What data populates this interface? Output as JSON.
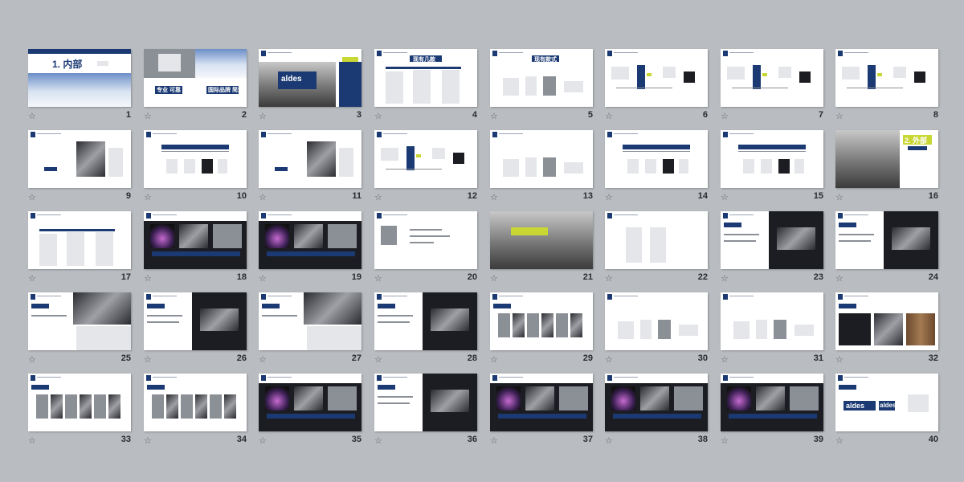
{
  "slides": [
    {
      "num": "1",
      "title": "1. 内部",
      "kind": "cover"
    },
    {
      "num": "2",
      "title": "专业  可靠",
      "title2": "国际品牌  简洁",
      "kind": "collage"
    },
    {
      "num": "3",
      "title": "aldes",
      "kind": "building"
    },
    {
      "num": "4",
      "title": "现有几款",
      "kind": "products"
    },
    {
      "num": "5",
      "title": "现有款式",
      "kind": "products2"
    },
    {
      "num": "6",
      "title": "",
      "kind": "diagram"
    },
    {
      "num": "7",
      "title": "",
      "kind": "diagram2"
    },
    {
      "num": "8",
      "title": "",
      "kind": "diagram3"
    },
    {
      "num": "9",
      "title": "",
      "kind": "product-device"
    },
    {
      "num": "10",
      "title": "",
      "kind": "table"
    },
    {
      "num": "11",
      "title": "",
      "kind": "product-device"
    },
    {
      "num": "12",
      "title": "",
      "kind": "diagram"
    },
    {
      "num": "13",
      "title": "",
      "kind": "products2"
    },
    {
      "num": "14",
      "title": "",
      "kind": "table"
    },
    {
      "num": "15",
      "title": "",
      "kind": "table"
    },
    {
      "num": "16",
      "title": "2. 外部",
      "kind": "city"
    },
    {
      "num": "17",
      "title": "",
      "kind": "products"
    },
    {
      "num": "18",
      "title": "",
      "kind": "dark-collage"
    },
    {
      "num": "19",
      "title": "",
      "kind": "dark-collage"
    },
    {
      "num": "20",
      "title": "",
      "kind": "text"
    },
    {
      "num": "21",
      "title": "",
      "kind": "citygrey"
    },
    {
      "num": "22",
      "title": "",
      "kind": "outline"
    },
    {
      "num": "23",
      "title": "",
      "kind": "split-dark"
    },
    {
      "num": "24",
      "title": "",
      "kind": "split-dark"
    },
    {
      "num": "25",
      "title": "",
      "kind": "split-metal"
    },
    {
      "num": "26",
      "title": "",
      "kind": "split-dark"
    },
    {
      "num": "27",
      "title": "",
      "kind": "split-metal"
    },
    {
      "num": "28",
      "title": "",
      "kind": "split-dark"
    },
    {
      "num": "29",
      "title": "",
      "kind": "swatches"
    },
    {
      "num": "30",
      "title": "",
      "kind": "products2"
    },
    {
      "num": "31",
      "title": "",
      "kind": "products2"
    },
    {
      "num": "32",
      "title": "",
      "kind": "wood"
    },
    {
      "num": "33",
      "title": "",
      "kind": "swatches"
    },
    {
      "num": "34",
      "title": "",
      "kind": "swatches"
    },
    {
      "num": "35",
      "title": "",
      "kind": "dark-collage"
    },
    {
      "num": "36",
      "title": "",
      "kind": "split-dark"
    },
    {
      "num": "37",
      "title": "",
      "kind": "dark-collage"
    },
    {
      "num": "38",
      "title": "",
      "kind": "dark-collage"
    },
    {
      "num": "39",
      "title": "",
      "kind": "dark-collage"
    },
    {
      "num": "40",
      "title": "aldes",
      "title2": "aldes",
      "kind": "logos"
    }
  ],
  "star_icon": "star-icon",
  "colors": {
    "background": "#b9bcc0",
    "brand_blue": "#1b3a73",
    "accent_lime": "#c9d735"
  }
}
